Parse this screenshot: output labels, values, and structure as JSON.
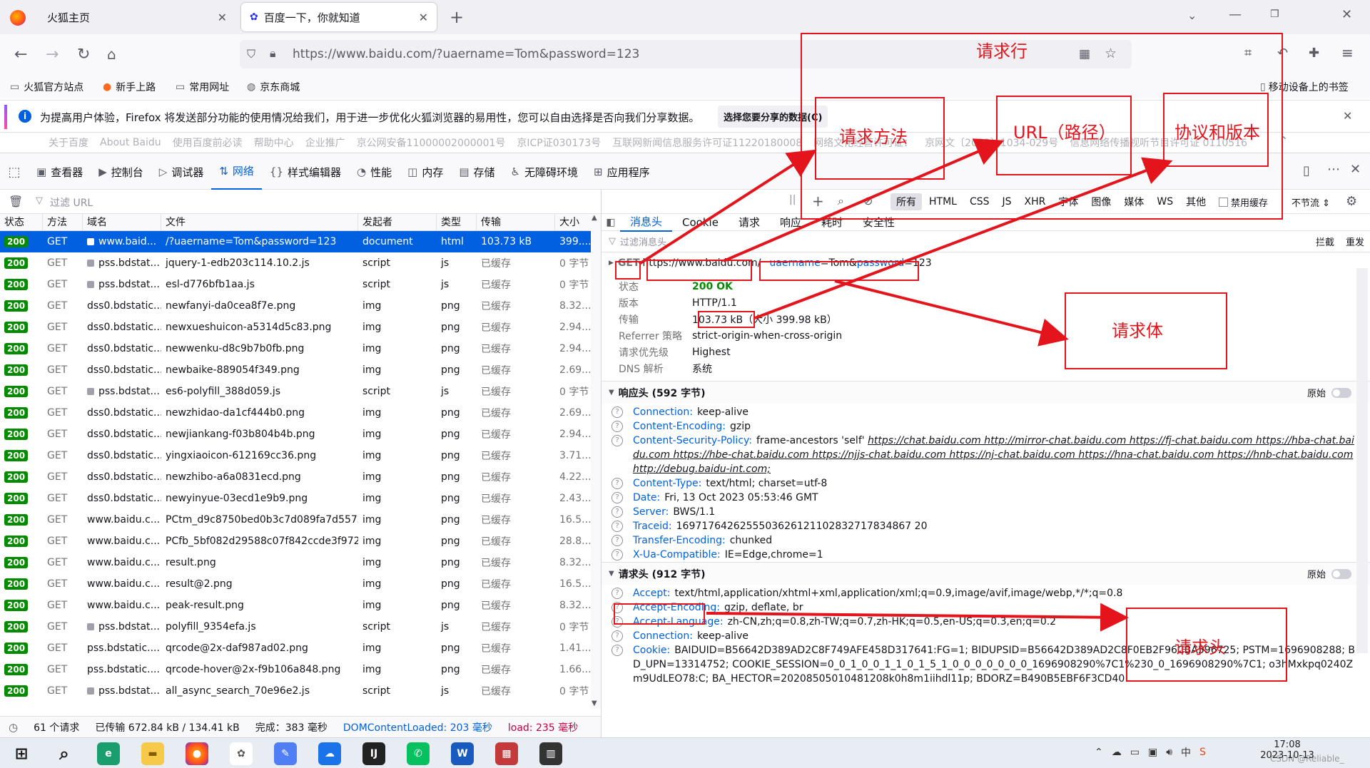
{
  "browser": {
    "tabs": [
      {
        "title": "火狐主页"
      },
      {
        "title": "百度一下，你就知道"
      }
    ],
    "url": "https://www.baidu.com/?uaername=Tom&password=123",
    "bookmarks": [
      "火狐官方站点",
      "新手上路",
      "常用网址",
      "京东商城"
    ],
    "mobile_bookmarks": "移动设备上的书签",
    "notice": "为提高用户体验，Firefox 将发送部分功能的使用情况给我们，用于进一步优化火狐浏览器的易用性，您可以自由选择是否向我们分享数据。",
    "notice_button": "选择您要分享的数据(C)",
    "footer_links": [
      "关于百度",
      "About Baidu",
      "使用百度前必读",
      "帮助中心",
      "企业推广",
      "京公网安备11000002000001号",
      "京ICP证030173号",
      "互联网新闻信息服务许可证11220180008",
      "网络文化经营许可证：",
      "京网文〔2023〕1034-029号",
      "信息网络传播视听节目许可证 0110516"
    ]
  },
  "devtools": {
    "tabs": [
      "查看器",
      "控制台",
      "调试器",
      "网络",
      "样式编辑器",
      "性能",
      "内存",
      "存储",
      "无障碍环境",
      "应用程序"
    ],
    "filter_placeholder": "过滤 URL",
    "type_filters": [
      "所有",
      "HTML",
      "CSS",
      "JS",
      "XHR",
      "字体",
      "图像",
      "媒体",
      "WS",
      "其他"
    ],
    "disable_cache": "禁用缓存",
    "throttle": "不节流 ⇕",
    "columns": [
      "状态",
      "方法",
      "域名",
      "文件",
      "发起者",
      "类型",
      "传输",
      "大小"
    ],
    "rows": [
      {
        "status": "200",
        "method": "GET",
        "domain": "www.baid...",
        "file": "/?uaername=Tom&password=123",
        "initiator": "document",
        "type": "html",
        "transfer": "103.73 kB",
        "size": "399....",
        "lock": true
      },
      {
        "status": "200",
        "method": "GET",
        "domain": "pss.bdstat...",
        "file": "jquery-1-edb203c114.10.2.js",
        "initiator": "script",
        "type": "js",
        "transfer": "已缓存",
        "size": "0 字节",
        "lock": true
      },
      {
        "status": "200",
        "method": "GET",
        "domain": "pss.bdstat...",
        "file": "esl-d776bfb1aa.js",
        "initiator": "script",
        "type": "js",
        "transfer": "已缓存",
        "size": "0 字节",
        "lock": true
      },
      {
        "status": "200",
        "method": "GET",
        "domain": "dss0.bdstatic...",
        "file": "newfanyi-da0cea8f7e.png",
        "initiator": "img",
        "type": "png",
        "transfer": "已缓存",
        "size": "8.32...",
        "lock": false
      },
      {
        "status": "200",
        "method": "GET",
        "domain": "dss0.bdstatic...",
        "file": "newxueshuicon-a5314d5c83.png",
        "initiator": "img",
        "type": "png",
        "transfer": "已缓存",
        "size": "2.94...",
        "lock": false
      },
      {
        "status": "200",
        "method": "GET",
        "domain": "dss0.bdstatic...",
        "file": "newwenku-d8c9b7b0fb.png",
        "initiator": "img",
        "type": "png",
        "transfer": "已缓存",
        "size": "2.94...",
        "lock": false
      },
      {
        "status": "200",
        "method": "GET",
        "domain": "dss0.bdstatic...",
        "file": "newbaike-889054f349.png",
        "initiator": "img",
        "type": "png",
        "transfer": "已缓存",
        "size": "2.69...",
        "lock": false
      },
      {
        "status": "200",
        "method": "GET",
        "domain": "pss.bdstat...",
        "file": "es6-polyfill_388d059.js",
        "initiator": "script",
        "type": "js",
        "transfer": "已缓存",
        "size": "0 字节",
        "lock": true
      },
      {
        "status": "200",
        "method": "GET",
        "domain": "dss0.bdstatic...",
        "file": "newzhidao-da1cf444b0.png",
        "initiator": "img",
        "type": "png",
        "transfer": "已缓存",
        "size": "2.69...",
        "lock": false
      },
      {
        "status": "200",
        "method": "GET",
        "domain": "dss0.bdstatic...",
        "file": "newjiankang-f03b804b4b.png",
        "initiator": "img",
        "type": "png",
        "transfer": "已缓存",
        "size": "2.94...",
        "lock": false
      },
      {
        "status": "200",
        "method": "GET",
        "domain": "dss0.bdstatic...",
        "file": "yingxiaoicon-612169cc36.png",
        "initiator": "img",
        "type": "png",
        "transfer": "已缓存",
        "size": "3.71...",
        "lock": false
      },
      {
        "status": "200",
        "method": "GET",
        "domain": "dss0.bdstatic...",
        "file": "newzhibo-a6a0831ecd.png",
        "initiator": "img",
        "type": "png",
        "transfer": "已缓存",
        "size": "4.22...",
        "lock": false
      },
      {
        "status": "200",
        "method": "GET",
        "domain": "dss0.bdstatic...",
        "file": "newyinyue-03ecd1e9b9.png",
        "initiator": "img",
        "type": "png",
        "transfer": "已缓存",
        "size": "2.43...",
        "lock": false
      },
      {
        "status": "200",
        "method": "GET",
        "domain": "www.baidu.c...",
        "file": "PCtm_d9c8750bed0b3c7d089fa7d55720",
        "initiator": "img",
        "type": "png",
        "transfer": "已缓存",
        "size": "16.5...",
        "lock": false
      },
      {
        "status": "200",
        "method": "GET",
        "domain": "www.baidu.c...",
        "file": "PCfb_5bf082d29588c07f842ccde3f97243",
        "initiator": "img",
        "type": "png",
        "transfer": "已缓存",
        "size": "28.8...",
        "lock": false
      },
      {
        "status": "200",
        "method": "GET",
        "domain": "www.baidu.c...",
        "file": "result.png",
        "initiator": "img",
        "type": "png",
        "transfer": "已缓存",
        "size": "8.32...",
        "lock": false
      },
      {
        "status": "200",
        "method": "GET",
        "domain": "www.baidu.c...",
        "file": "result@2.png",
        "initiator": "img",
        "type": "png",
        "transfer": "已缓存",
        "size": "16.5...",
        "lock": false
      },
      {
        "status": "200",
        "method": "GET",
        "domain": "www.baidu.c...",
        "file": "peak-result.png",
        "initiator": "img",
        "type": "png",
        "transfer": "已缓存",
        "size": "8.32...",
        "lock": false
      },
      {
        "status": "200",
        "method": "GET",
        "domain": "pss.bdstat...",
        "file": "polyfill_9354efa.js",
        "initiator": "script",
        "type": "js",
        "transfer": "已缓存",
        "size": "0 字节",
        "lock": true
      },
      {
        "status": "200",
        "method": "GET",
        "domain": "pss.bdstatic....",
        "file": "qrcode@2x-daf987ad02.png",
        "initiator": "img",
        "type": "png",
        "transfer": "已缓存",
        "size": "1.41...",
        "lock": false
      },
      {
        "status": "200",
        "method": "GET",
        "domain": "pss.bdstatic....",
        "file": "qrcode-hover@2x-f9b106a848.png",
        "initiator": "img",
        "type": "png",
        "transfer": "已缓存",
        "size": "1.66...",
        "lock": false
      },
      {
        "status": "200",
        "method": "GET",
        "domain": "pss.bdstat...",
        "file": "all_async_search_70e96e2.js",
        "initiator": "script",
        "type": "js",
        "transfer": "已缓存",
        "size": "0 字节",
        "lock": true
      }
    ],
    "status_bar": {
      "requests": "61 个请求",
      "transferred": "已传输 672.84 kB / 134.41 kB",
      "finish": "完成：383 毫秒",
      "dcl": "DOMContentLoaded: 203 毫秒",
      "load": "load: 235 毫秒"
    },
    "detail_tabs": [
      "消息头",
      "Cookie",
      "请求",
      "响应",
      "耗时",
      "安全性"
    ],
    "detail_filter": "过滤消息头",
    "block": "拦截",
    "resend": "重发",
    "request_line": {
      "method": "GET",
      "host": "https://www.baidu.com/",
      "query_name1": "uaername",
      "query_val1": "Tom",
      "amp": "&",
      "query_name2": "password",
      "query_val2": "123"
    },
    "summary": [
      {
        "k": "状态",
        "v": "200 OK"
      },
      {
        "k": "版本",
        "v": "HTTP/1.1"
      },
      {
        "k": "传输",
        "v": "103.73 kB（大小 399.98 kB）"
      },
      {
        "k": "Referrer 策略",
        "v": "strict-origin-when-cross-origin"
      },
      {
        "k": "请求优先级",
        "v": "Highest"
      },
      {
        "k": "DNS 解析",
        "v": "系统"
      }
    ],
    "response_headers_title": "响应头 (592 字节)",
    "raw": "原始",
    "response_headers": [
      {
        "n": "Connection:",
        "v": "keep-alive"
      },
      {
        "n": "Content-Encoding:",
        "v": "gzip"
      },
      {
        "n": "Content-Security-Policy:",
        "v": "frame-ancestors 'self' ",
        "links": "https://chat.baidu.com http://mirror-chat.baidu.com https://fj-chat.baidu.com https://hba-chat.baidu.com https://hbe-chat.baidu.com https://njjs-chat.baidu.com https://nj-chat.baidu.com https://hna-chat.baidu.com https://hnb-chat.baidu.com http://debug.baidu-int.com;"
      },
      {
        "n": "Content-Type:",
        "v": "text/html; charset=utf-8"
      },
      {
        "n": "Date:",
        "v": "Fri, 13 Oct 2023 05:53:46 GMT"
      },
      {
        "n": "Server:",
        "v": "BWS/1.1"
      },
      {
        "n": "Traceid:",
        "v": "1697176426255503626121102832717834867 20"
      },
      {
        "n": "Transfer-Encoding:",
        "v": "chunked"
      },
      {
        "n": "X-Ua-Compatible:",
        "v": "IE=Edge,chrome=1"
      }
    ],
    "request_headers_title": "请求头 (912 字节)",
    "request_headers": [
      {
        "n": "Accept:",
        "v": "text/html,application/xhtml+xml,application/xml;q=0.9,image/avif,image/webp,*/*;q=0.8"
      },
      {
        "n": "Accept-Encoding:",
        "v": "gzip, deflate, br"
      },
      {
        "n": "Accept-Language:",
        "v": "zh-CN,zh;q=0.8,zh-TW;q=0.7,zh-HK;q=0.5,en-US;q=0.3,en;q=0.2"
      },
      {
        "n": "Connection:",
        "v": "keep-alive"
      },
      {
        "n": "Cookie:",
        "v": "BAIDUID=B56642D389AD2C8F749AFE458D317641:FG=1; BIDUPSID=B56642D389AD2C8F0EB2F96CBA596725; PSTM=1696908288; BD_UPN=13314752; COOKIE_SESSION=0_0_1_0_0_1_1_0_1_5_1_0_0_0_0_0_0_0_1696908290%7C1%230_0_1696908290%7C1; o3hMxkpq0240Zm9UdLEO78:C; BA_HECTOR=20208505010481208k0h8m1iihdl11p; BDORZ=B490B5EBF6F3CD40"
      }
    ]
  },
  "annotations": {
    "request_line": "请求行",
    "method": "请求方法",
    "url": "URL（路径）",
    "proto": "协议和版本",
    "body": "请求体",
    "headers": "请求头"
  },
  "taskbar": {
    "time": "17:08",
    "date": "2023-10-13",
    "watermark": "CSDN @Reliable_"
  },
  "colors": {
    "accent": "#0060df",
    "status_ok": "#058b00",
    "annotation": "#e3141c"
  }
}
